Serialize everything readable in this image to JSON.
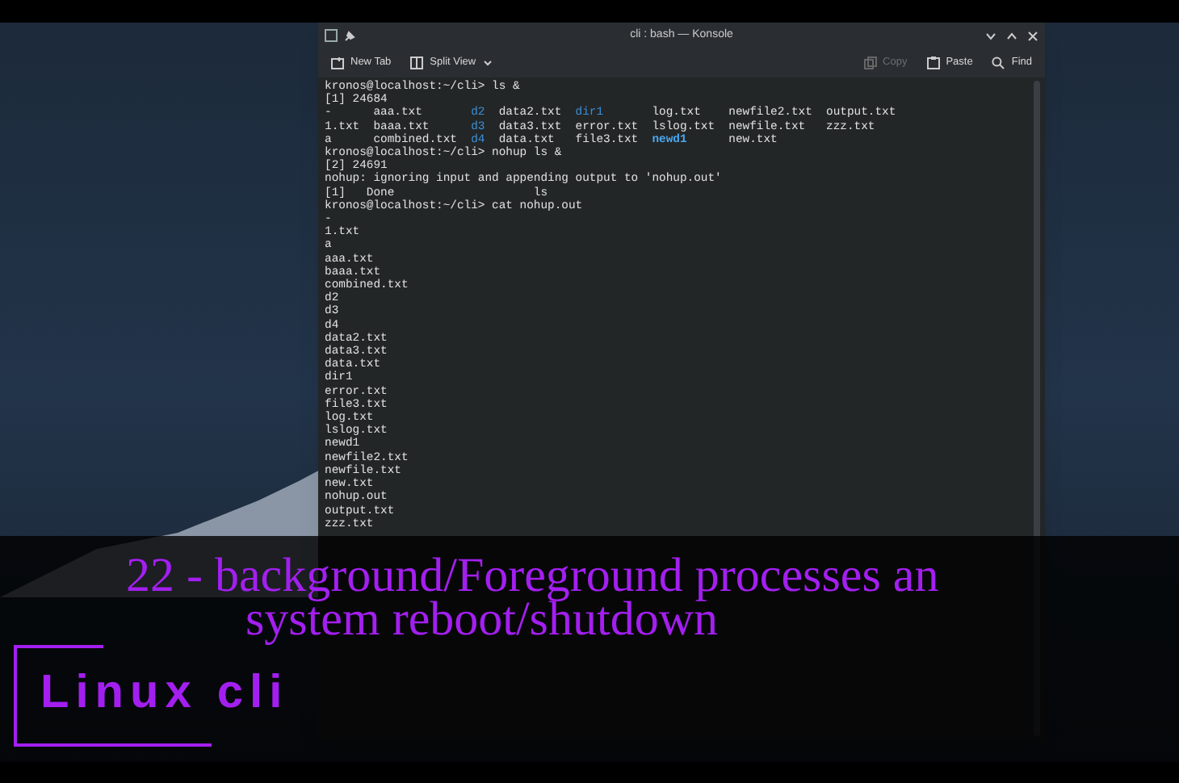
{
  "window": {
    "title": "cli : bash — Konsole"
  },
  "toolbar": {
    "left": [
      {
        "label": "New Tab",
        "disabled": false
      },
      {
        "label": "Split View",
        "disabled": false,
        "dropdown": true
      }
    ],
    "right": [
      {
        "label": "Copy",
        "disabled": true
      },
      {
        "label": "Paste",
        "disabled": false
      },
      {
        "label": "Find",
        "disabled": false
      }
    ]
  },
  "terminal": {
    "lines": [
      {
        "kind": "text",
        "text": "kronos@localhost:~/cli> ls &"
      },
      {
        "kind": "text",
        "text": "[1] 24684"
      },
      {
        "kind": "ls_row",
        "cells": [
          {
            "text": "-",
            "kind": "file"
          },
          {
            "text": "aaa.txt",
            "kind": "file"
          },
          {
            "text": "d2",
            "kind": "dir"
          },
          {
            "text": "data2.txt",
            "kind": "file"
          },
          {
            "text": "dir1",
            "kind": "dir"
          },
          {
            "text": "log.txt",
            "kind": "file"
          },
          {
            "text": "newfile2.txt",
            "kind": "file"
          },
          {
            "text": "output.txt",
            "kind": "file"
          }
        ]
      },
      {
        "kind": "ls_row",
        "cells": [
          {
            "text": "1.txt",
            "kind": "file"
          },
          {
            "text": "baaa.txt",
            "kind": "file"
          },
          {
            "text": "d3",
            "kind": "dir"
          },
          {
            "text": "data3.txt",
            "kind": "file"
          },
          {
            "text": "error.txt",
            "kind": "file"
          },
          {
            "text": "lslog.txt",
            "kind": "file"
          },
          {
            "text": "newfile.txt",
            "kind": "file"
          },
          {
            "text": "zzz.txt",
            "kind": "file"
          }
        ]
      },
      {
        "kind": "ls_row",
        "cells": [
          {
            "text": "a",
            "kind": "file"
          },
          {
            "text": "combined.txt",
            "kind": "file"
          },
          {
            "text": "d4",
            "kind": "dir"
          },
          {
            "text": "data.txt",
            "kind": "file"
          },
          {
            "text": "file3.txt",
            "kind": "file"
          },
          {
            "text": "newd1",
            "kind": "dirbold"
          },
          {
            "text": "new.txt",
            "kind": "file"
          }
        ]
      },
      {
        "kind": "text",
        "text": "kronos@localhost:~/cli> nohup ls &"
      },
      {
        "kind": "text",
        "text": "[2] 24691"
      },
      {
        "kind": "text",
        "text": "nohup: ignoring input and appending output to 'nohup.out'"
      },
      {
        "kind": "text",
        "text": "[1]   Done                    ls"
      },
      {
        "kind": "text",
        "text": "kronos@localhost:~/cli> cat nohup.out"
      },
      {
        "kind": "text",
        "text": "-"
      },
      {
        "kind": "text",
        "text": "1.txt"
      },
      {
        "kind": "text",
        "text": "a"
      },
      {
        "kind": "text",
        "text": "aaa.txt"
      },
      {
        "kind": "text",
        "text": "baaa.txt"
      },
      {
        "kind": "text",
        "text": "combined.txt"
      },
      {
        "kind": "text",
        "text": "d2"
      },
      {
        "kind": "text",
        "text": "d3"
      },
      {
        "kind": "text",
        "text": "d4"
      },
      {
        "kind": "text",
        "text": "data2.txt"
      },
      {
        "kind": "text",
        "text": "data3.txt"
      },
      {
        "kind": "text",
        "text": "data.txt"
      },
      {
        "kind": "text",
        "text": "dir1"
      },
      {
        "kind": "text",
        "text": "error.txt"
      },
      {
        "kind": "text",
        "text": "file3.txt"
      },
      {
        "kind": "text",
        "text": "log.txt"
      },
      {
        "kind": "text",
        "text": "lslog.txt"
      },
      {
        "kind": "text",
        "text": "newd1"
      },
      {
        "kind": "text",
        "text": "newfile2.txt"
      },
      {
        "kind": "text",
        "text": "newfile.txt"
      },
      {
        "kind": "text",
        "text": "new.txt"
      },
      {
        "kind": "text",
        "text": "nohup.out"
      },
      {
        "kind": "text",
        "text": "output.txt"
      },
      {
        "kind": "text",
        "text": "zzz.txt"
      }
    ]
  },
  "overlay": {
    "title_lines": [
      "22 - background/Foreground processes an",
      "system reboot/shutdown"
    ],
    "badge": "Linux cli"
  }
}
